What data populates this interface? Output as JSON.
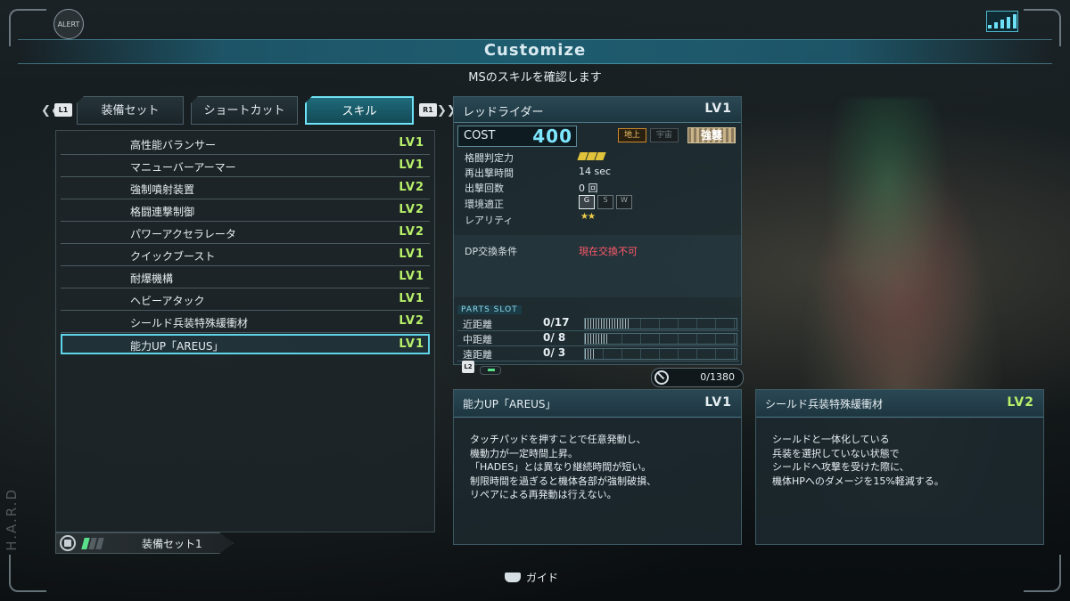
{
  "hud": {
    "alert_label": "ALERT",
    "side_text": "H.A.R.D",
    "header_title": "Customize",
    "subtitle": "MSのスキルを確認します"
  },
  "tabs": {
    "left_shoulder": "L1",
    "right_shoulder": "R1",
    "items": [
      {
        "label": "装備セット",
        "active": false
      },
      {
        "label": "ショートカット",
        "active": false
      },
      {
        "label": "スキル",
        "active": true
      }
    ]
  },
  "skills": [
    {
      "name": "高性能バランサー",
      "level": "LV1"
    },
    {
      "name": "マニューバーアーマー",
      "level": "LV1"
    },
    {
      "name": "強制噴射装置",
      "level": "LV2"
    },
    {
      "name": "格闘連撃制御",
      "level": "LV2"
    },
    {
      "name": "パワーアクセラレータ",
      "level": "LV2"
    },
    {
      "name": "クイックブースト",
      "level": "LV1"
    },
    {
      "name": "耐爆機構",
      "level": "LV1"
    },
    {
      "name": "ヘビーアタック",
      "level": "LV1"
    },
    {
      "name": "シールド兵装特殊緩衝材",
      "level": "LV2"
    },
    {
      "name": "能力UP「AREUS」",
      "level": "LV1",
      "selected": true
    }
  ],
  "loadout": {
    "label": "装備セット1",
    "bars_total": 3,
    "bars_on": 1
  },
  "unit": {
    "name": "レッドライダー",
    "level": "LV1",
    "cost_label": "COST",
    "cost_value": "400",
    "terrain_ground": "地上",
    "terrain_space": "宇宙",
    "raid_label": "強襲",
    "stats": [
      {
        "label": "格闘判定力",
        "value": ""
      },
      {
        "label": "再出撃時間",
        "value": "14 sec"
      },
      {
        "label": "出撃回数",
        "value": "0 回"
      },
      {
        "label": "環境適正",
        "value": ""
      },
      {
        "label": "レアリティ",
        "value": "★★"
      }
    ],
    "melee_rank_icons": 3,
    "environment_badges": [
      {
        "label": "G",
        "active": true
      },
      {
        "label": "S",
        "active": false
      },
      {
        "label": "W",
        "active": false
      }
    ],
    "dp_label": "DP交換条件",
    "dp_value": "現在交換不可",
    "parts_slot_title": "PARTS SLOT",
    "parts": [
      {
        "label": "近距離",
        "count": "0/17",
        "fill": 0.3
      },
      {
        "label": "中距離",
        "count": "0/ 8",
        "fill": 0.15
      },
      {
        "label": "遠距離",
        "count": "0/ 3",
        "fill": 0.07
      }
    ],
    "l2_tag": "L2",
    "custom_value": "0/1380"
  },
  "descriptions": [
    {
      "name": "能力UP「AREUS」",
      "level": "LV1",
      "text": "タッチパッドを押すことで任意発動し、\n機動力が一定時間上昇。\n「HADES」とは異なり継続時間が短い。\n制限時間を過ぎると機体各部が強制破損、\nリペアによる再発動は行えない。"
    },
    {
      "name": "シールド兵装特殊緩衝材",
      "level": "LV2",
      "text": "シールドと一体化している\n兵装を選択していない状態で\nシールドへ攻撃を受けた際に、\n機体HPへのダメージを15%軽減する。"
    }
  ],
  "footer": {
    "guide_label": "ガイド"
  },
  "colors": {
    "accent_cyan": "#6fe3f7",
    "level_green": "#b8f06a",
    "cost_blue": "#7ee7ff",
    "warning_red": "#ff5a6a"
  }
}
